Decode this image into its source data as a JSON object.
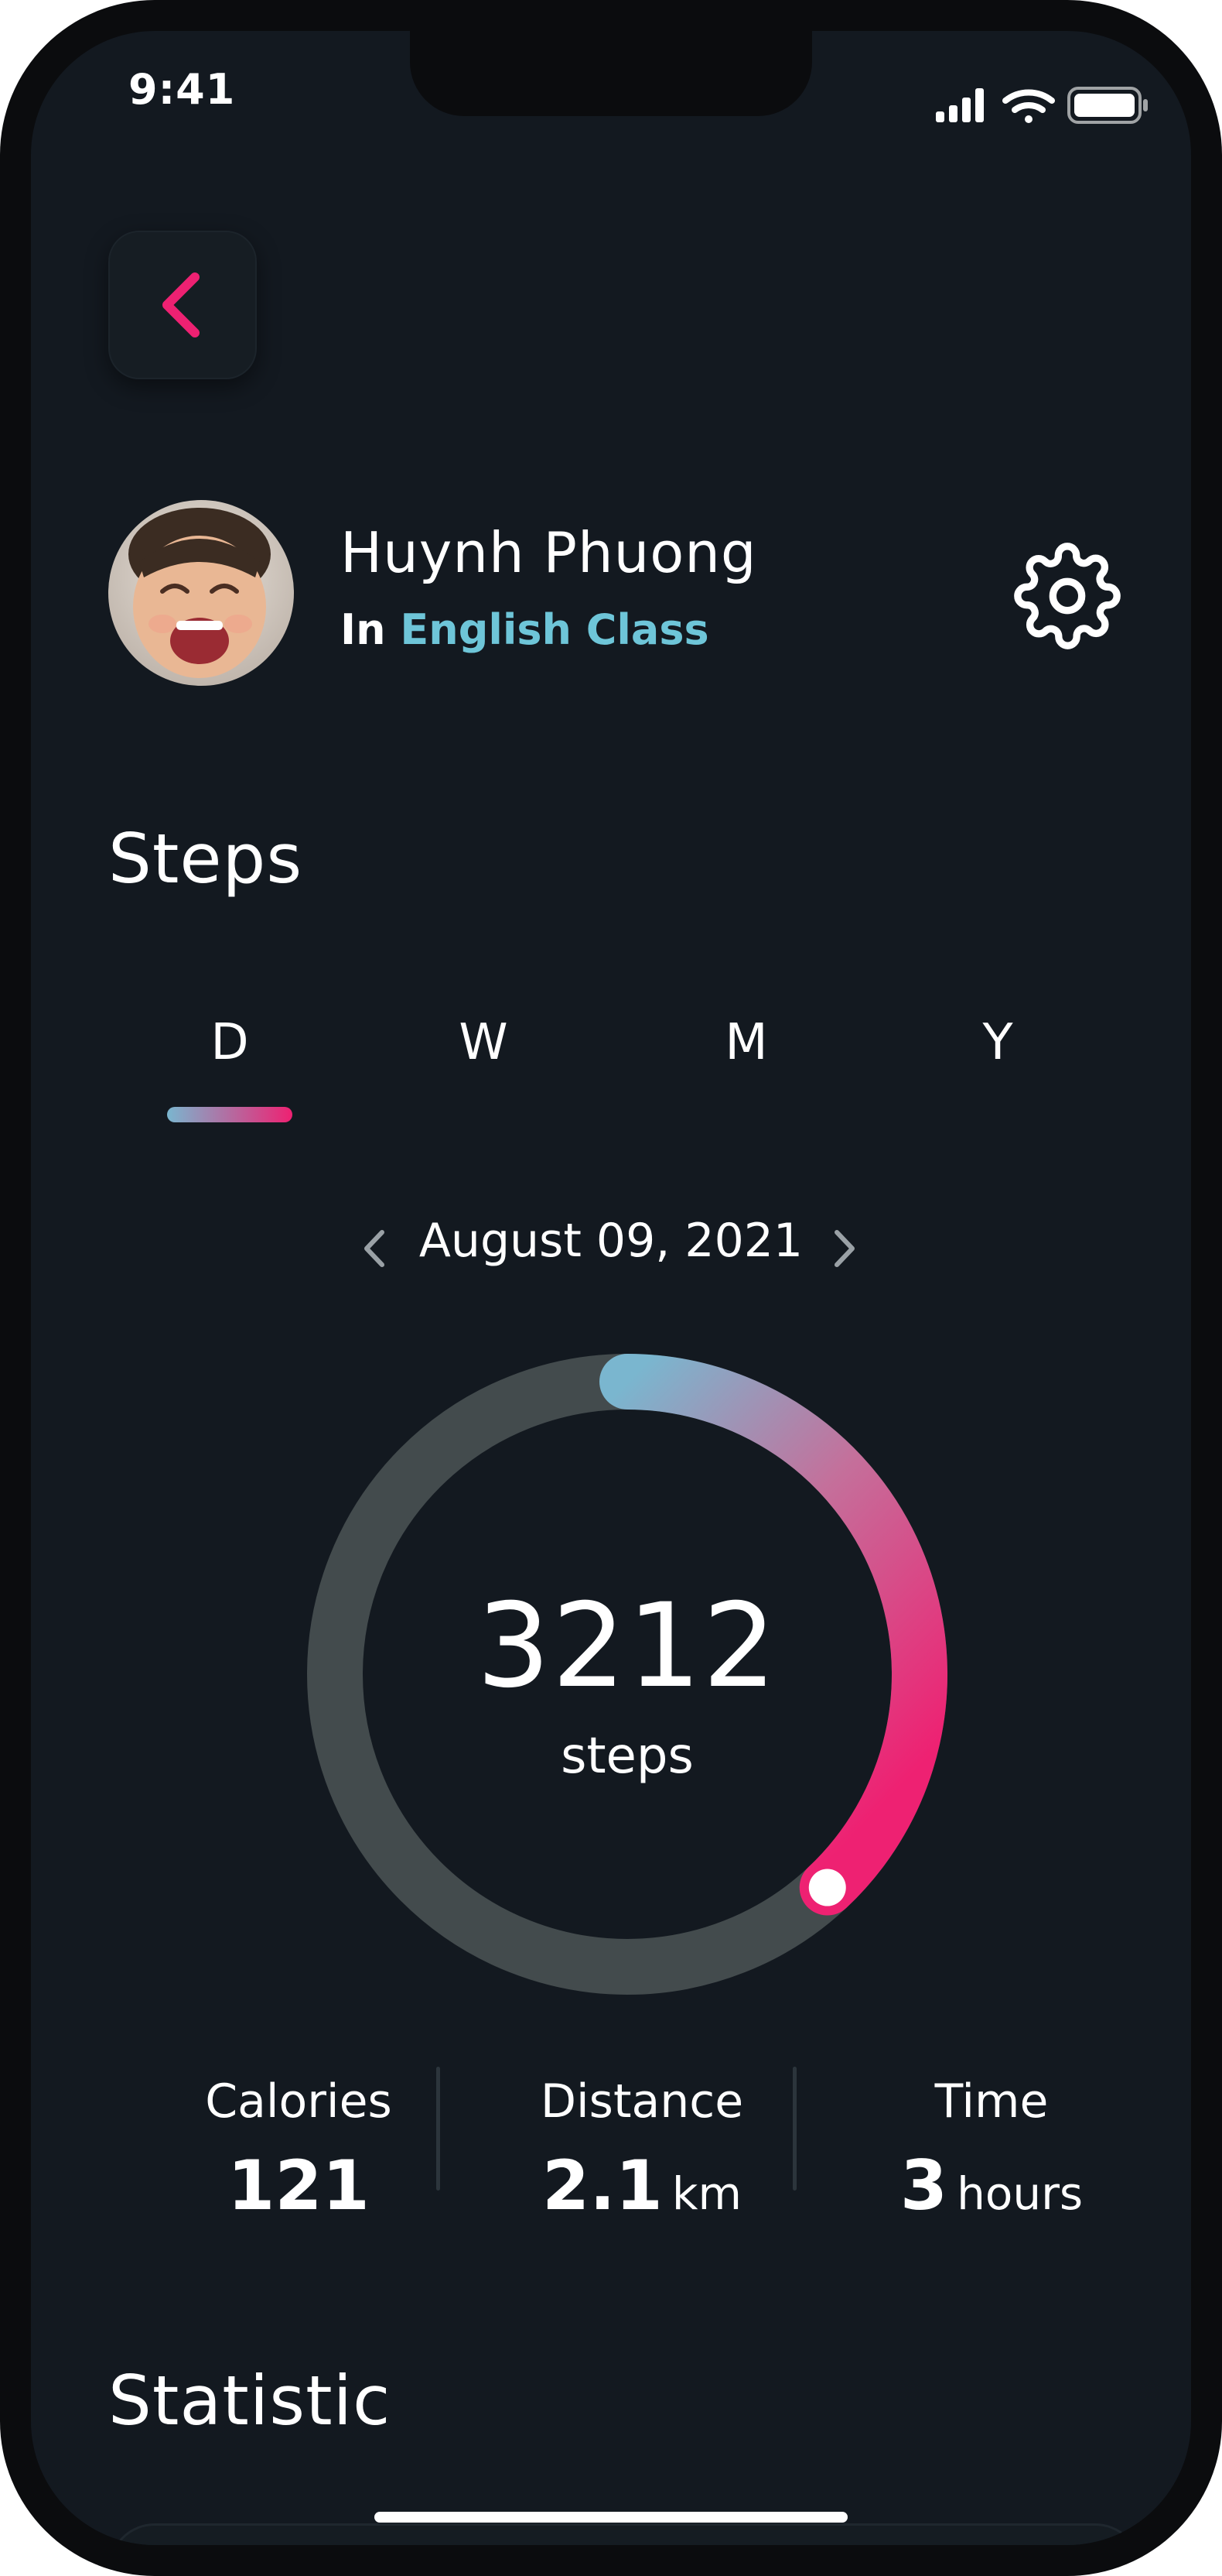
{
  "status_bar": {
    "time": "9:41"
  },
  "profile": {
    "name": "Huynh Phuong",
    "class_prefix": "In",
    "class_name": "English Class"
  },
  "steps_section": {
    "title": "Steps"
  },
  "period_tabs": {
    "items": [
      "D",
      "W",
      "M",
      "Y"
    ],
    "selected": "D"
  },
  "date_nav": {
    "date": "August 09, 2021"
  },
  "ring": {
    "value": "3212",
    "unit": "steps",
    "progress_fraction": 0.38
  },
  "stats": {
    "calories": {
      "label": "Calories",
      "value": "121"
    },
    "distance": {
      "label": "Distance",
      "value": "2.1",
      "unit": "km"
    },
    "time": {
      "label": "Time",
      "value": "3",
      "unit": "hours"
    }
  },
  "statistic_section": {
    "title": "Statistic"
  },
  "colors": {
    "background": "#131920",
    "accent_pink": "#ee2172",
    "accent_blue": "#7ab6cf",
    "class_link": "#6ec5d8",
    "ring_track": "#434b4d"
  },
  "icons": {
    "back": "chevron-left-icon",
    "settings": "gear-icon",
    "prev_date": "chevron-left-icon",
    "next_date": "chevron-right-icon",
    "signal": "cellular-signal-icon",
    "wifi": "wifi-icon",
    "battery": "battery-icon"
  }
}
